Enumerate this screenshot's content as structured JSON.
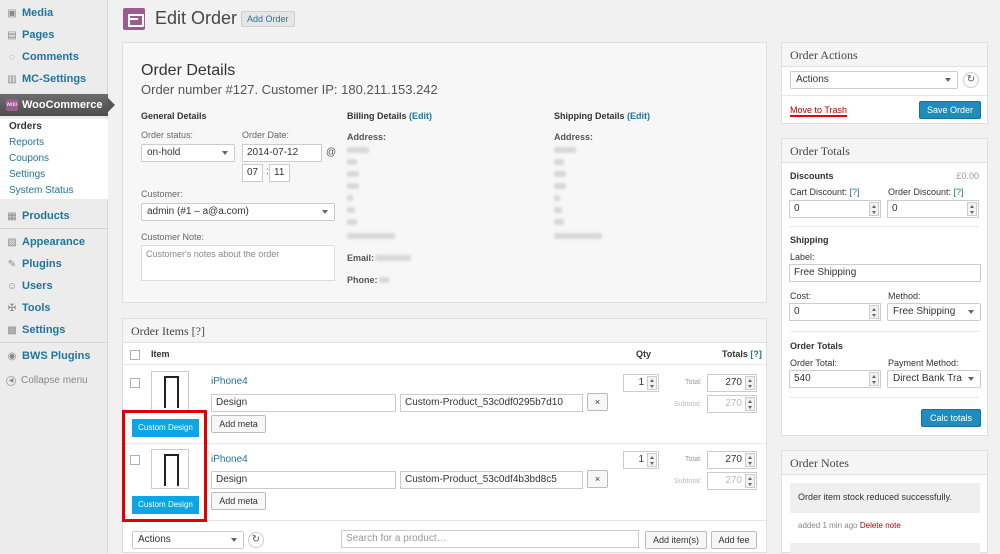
{
  "sidebar": {
    "media": "Media",
    "pages": "Pages",
    "comments": "Comments",
    "mc_settings": "MC-Settings",
    "woocommerce": "WooCommerce",
    "woo_badge": "woo",
    "orders": "Orders",
    "reports": "Reports",
    "coupons": "Coupons",
    "settings_sub": "Settings",
    "system_status": "System Status",
    "products": "Products",
    "appearance": "Appearance",
    "plugins": "Plugins",
    "users": "Users",
    "tools": "Tools",
    "settings": "Settings",
    "bws_plugins": "BWS Plugins",
    "collapse": "Collapse menu"
  },
  "header": {
    "title": "Edit Order",
    "add_order": "Add Order"
  },
  "order_details": {
    "title": "Order Details",
    "subtitle": "Order number #127. Customer IP: 180.211.153.242",
    "general": "General Details",
    "status_label": "Order status:",
    "status_value": "on-hold",
    "date_label": "Order Date:",
    "date_value": "2014-07-12",
    "at": "@",
    "hour": "07",
    "colon": ":",
    "minute": "11",
    "customer_label": "Customer:",
    "customer_value": "admin (#1 – a@a.com)",
    "note_label": "Customer Note:",
    "note_placeholder": "Customer's notes about the order",
    "billing": "Billing Details",
    "billing_edit": "(Edit)",
    "shipping": "Shipping Details",
    "shipping_edit": "(Edit)",
    "address_label": "Address:",
    "email_label": "Email:",
    "phone_label": "Phone:"
  },
  "order_items": {
    "title": "Order Items [?]",
    "col_item": "Item",
    "col_qty": "Qty",
    "col_totals": "Totals",
    "col_totals_help": "[?]",
    "total_label": "Total:",
    "subtotal_label": "Subtotal:",
    "add_meta": "Add meta",
    "custom_design": "Custom Design",
    "remove": "×",
    "items": [
      {
        "name": "iPhone4",
        "meta_key": "Design",
        "meta_value": "Custom-Product_53c0df0295b7d10",
        "qty": "1",
        "total": "270",
        "subtotal": "270"
      },
      {
        "name": "iPhone4",
        "meta_key": "Design",
        "meta_value": "Custom-Product_53c0df4b3bd8c5",
        "qty": "1",
        "total": "270",
        "subtotal": "270"
      }
    ],
    "actions": "Actions",
    "search_placeholder": "Search for a product…",
    "add_items": "Add item(s)",
    "add_fee": "Add fee"
  },
  "order_actions": {
    "title": "Order Actions",
    "select": "Actions",
    "trash": "Move to Trash",
    "save": "Save Order"
  },
  "order_totals": {
    "title": "Order Totals",
    "discounts": "Discounts",
    "discounts_amount": "£0.00",
    "cart_discount": "Cart Discount:",
    "order_discount": "Order Discount:",
    "help": "[?]",
    "cart_discount_value": "0",
    "order_discount_value": "0",
    "shipping": "Shipping",
    "label": "Label:",
    "label_value": "Free Shipping",
    "cost": "Cost:",
    "cost_value": "0",
    "method": "Method:",
    "method_value": "Free Shipping",
    "order_totals": "Order Totals",
    "order_total": "Order Total:",
    "order_total_value": "540",
    "payment_method": "Payment Method:",
    "payment_method_value": "Direct Bank Tra",
    "calc": "Calc totals"
  },
  "order_notes": {
    "title": "Order Notes",
    "note": "Order item stock reduced successfully.",
    "meta": "added 1 min ago",
    "delete": "Delete note"
  }
}
